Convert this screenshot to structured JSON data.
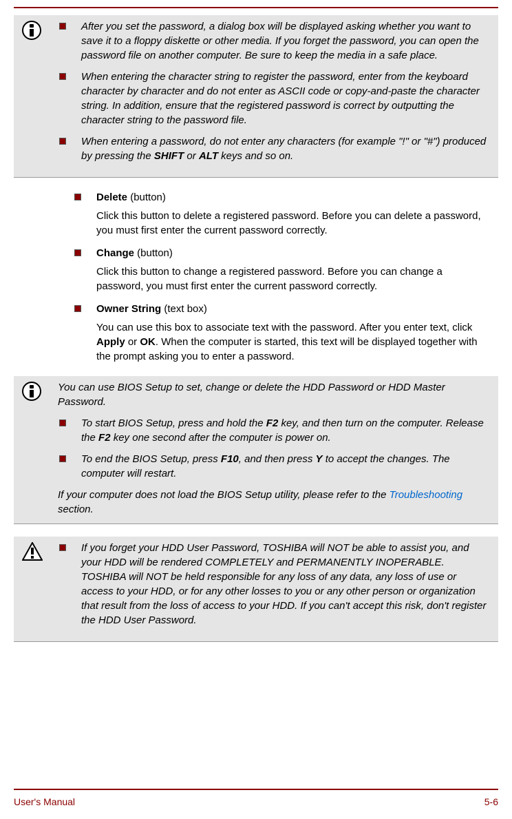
{
  "infobox1": {
    "items": [
      "After you set the password, a dialog box will be displayed asking whether you want to save it to a floppy diskette or other media. If you forget the password, you can open the password file on another computer. Be sure to keep the media in a safe place.",
      "When entering the character string to register the password, enter from the keyboard character by character and do not enter as ASCII code or copy-and-paste the character string. In addition, ensure that the registered password is correct by outputting the character string to the password file.",
      "When entering a password, do not enter any characters (for example \"!\" or \"#\") produced by pressing the SHIFT or ALT keys and so on."
    ]
  },
  "mainlist": [
    {
      "title_bold": "Delete",
      "title_rest": " (button)",
      "desc": "Click this button to delete a registered password. Before you can delete a password, you must first enter the current password correctly."
    },
    {
      "title_bold": "Change",
      "title_rest": " (button)",
      "desc": "Click this button to change a registered password. Before you can change a password, you must first enter the current password correctly."
    },
    {
      "title_bold": "Owner String",
      "title_rest": " (text box)",
      "desc_pre": "You can use this box to associate text with the password. After you enter text, click ",
      "desc_b1": "Apply",
      "desc_mid": " or ",
      "desc_b2": "OK",
      "desc_post": ". When the computer is started, this text will be displayed together with the prompt asking you to enter a password."
    }
  ],
  "infobox2": {
    "intro": "You can use BIOS Setup to set, change or delete the HDD Password or HDD Master Password.",
    "items": [
      {
        "pre": "To start BIOS Setup, press and hold the ",
        "b1": "F2",
        "mid1": " key, and then turn on the computer. Release the ",
        "b2": "F2",
        "mid2": " key one second after the computer is power on.",
        "b3": "",
        "post": ""
      },
      {
        "pre": "To end the BIOS Setup, press ",
        "b1": "F10",
        "mid1": ", and then press ",
        "b2": "Y",
        "mid2": " to accept the changes. The computer will restart.",
        "b3": "",
        "post": ""
      }
    ],
    "refer_pre": "If your computer does not load the BIOS Setup utility, please refer to the ",
    "refer_link": "Troubleshooting",
    "refer_post": " section."
  },
  "warningbox": {
    "text": "If you forget your HDD User Password, TOSHIBA will NOT be able to assist you, and your HDD will be rendered COMPLETELY and PERMANENTLY INOPERABLE. TOSHIBA will NOT be held responsible for any loss of any data, any loss of use or access to your HDD, or for any other losses to you or any other person or organization that result from the loss of access to your HDD. If you can't accept this risk, don't register the HDD User Password."
  },
  "footer": {
    "left": "User's Manual",
    "right": "5-6"
  }
}
